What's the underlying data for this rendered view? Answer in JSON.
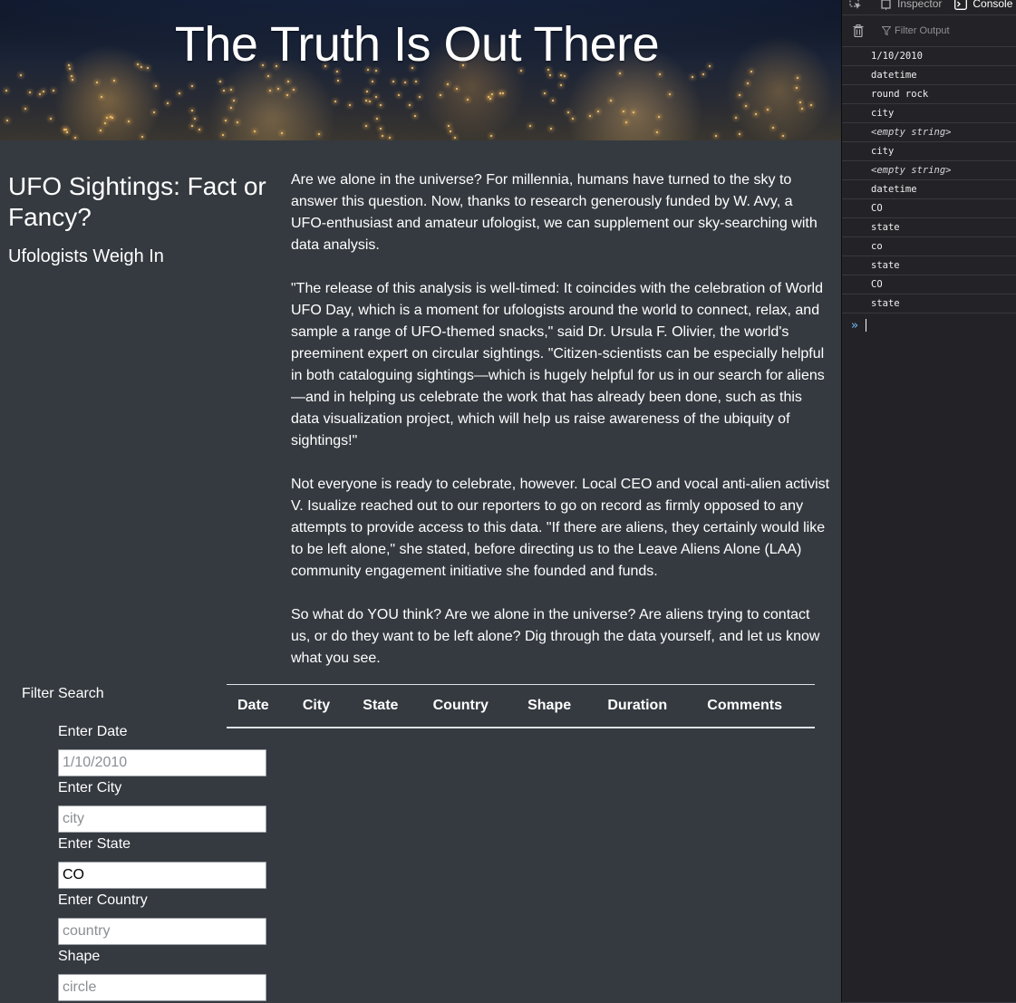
{
  "hero": {
    "title": "The Truth Is Out There"
  },
  "sidebar": {
    "heading": "UFO Sightings: Fact or Fancy?",
    "subheading": "Ufologists Weigh In"
  },
  "article": {
    "paragraphs": [
      "Are we alone in the universe? For millennia, humans have turned to the sky to answer this question. Now, thanks to research generously funded by W. Avy, a UFO-enthusiast and amateur ufologist, we can supplement our sky-searching with data analysis.",
      "\"The release of this analysis is well-timed: It coincides with the celebration of World UFO Day, which is a moment for ufologists around the world to connect, relax, and sample a range of UFO-themed snacks,\" said Dr. Ursula F. Olivier, the world's preeminent expert on circular sightings. \"Citizen-scientists can be especially helpful in both cataloguing sightings—which is hugely helpful for us in our search for aliens—and in helping us celebrate the work that has already been done, such as this data visualization project, which will help us raise awareness of the ubiquity of sightings!\"",
      "Not everyone is ready to celebrate, however. Local CEO and vocal anti-alien activist V. Isualize reached out to our reporters to go on record as firmly opposed to any attempts to provide access to this data. \"If there are aliens, they certainly would like to be left alone,\" she stated, before directing us to the Leave Aliens Alone (LAA) community engagement initiative she founded and funds.",
      "So what do YOU think? Are we alone in the universe? Are aliens trying to contact us, or do they want to be left alone? Dig through the data yourself, and let us know what you see."
    ]
  },
  "filters": {
    "title": "Filter Search",
    "fields": [
      {
        "label": "Enter Date",
        "placeholder": "1/10/2010",
        "value": ""
      },
      {
        "label": "Enter City",
        "placeholder": "city",
        "value": ""
      },
      {
        "label": "Enter State",
        "placeholder": "",
        "value": "CO"
      },
      {
        "label": "Enter Country",
        "placeholder": "country",
        "value": ""
      },
      {
        "label": "Shape",
        "placeholder": "circle",
        "value": ""
      }
    ]
  },
  "table": {
    "headers": [
      "Date",
      "City",
      "State",
      "Country",
      "Shape",
      "Duration",
      "Comments"
    ]
  },
  "devtools": {
    "tabs": [
      "Inspector",
      "Console"
    ],
    "active_tab": "Console",
    "filter_placeholder": "Filter Output",
    "log": [
      "1/10/2010",
      "datetime",
      "round rock",
      "city",
      "<empty string>",
      "city",
      "<empty string>",
      "datetime",
      "CO",
      "state",
      "co",
      "state",
      "CO",
      "state"
    ],
    "prompt_symbol": "»"
  },
  "icons": {
    "pick": "cursor-pick-icon",
    "inspector": "inspector-icon",
    "console": "console-icon",
    "trash": "trash-icon",
    "filter": "filter-icon"
  },
  "colors": {
    "page_bg": "#353a40",
    "devtools_bg": "#232327",
    "prompt_accent": "#75bfff"
  }
}
